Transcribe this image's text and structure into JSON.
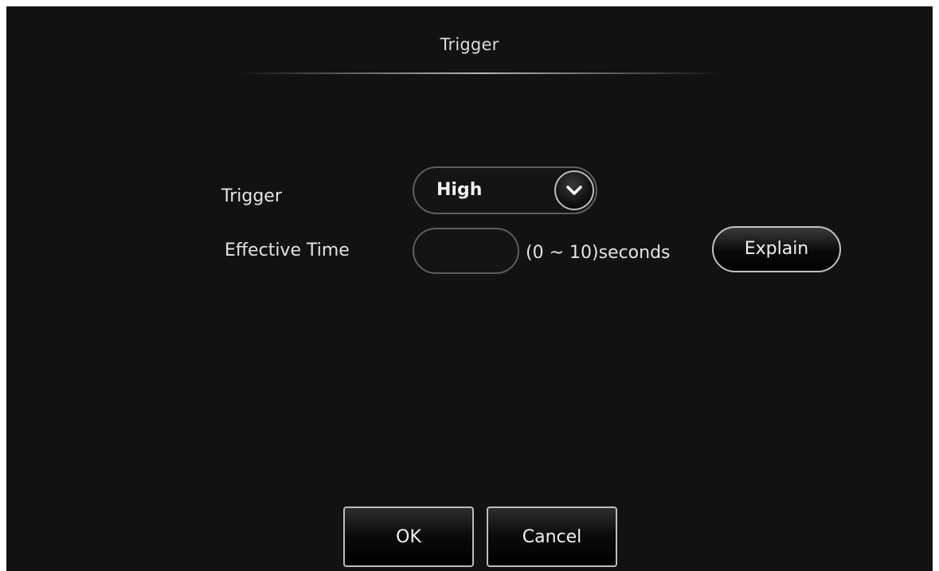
{
  "dialog": {
    "title": "Trigger"
  },
  "form": {
    "trigger": {
      "label": "Trigger",
      "value": "High"
    },
    "effective_time": {
      "label": "Effective Time",
      "value": "",
      "range_text": "(0 ~ 10)seconds"
    },
    "explain_label": "Explain"
  },
  "buttons": {
    "ok_label": "OK",
    "cancel_label": "Cancel"
  }
}
